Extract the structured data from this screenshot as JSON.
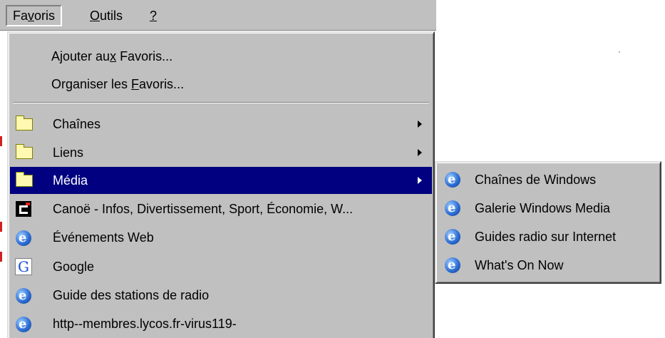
{
  "menubar": {
    "items": [
      {
        "label_pre": "Fa",
        "label_ul": "v",
        "label_post": "oris"
      },
      {
        "label_pre": "",
        "label_ul": "O",
        "label_post": "utils"
      },
      {
        "label_pre": "",
        "label_ul": "?",
        "label_post": ""
      }
    ]
  },
  "favorites_menu": {
    "add": {
      "pre": "Ajouter au",
      "ul": "x",
      "post": " Favoris..."
    },
    "organize": {
      "pre": "Organiser les ",
      "ul": "F",
      "post": "avoris..."
    },
    "items": [
      {
        "label": "Chaînes",
        "icon": "folder-icon",
        "submenu": true
      },
      {
        "label": "Liens",
        "icon": "folder-icon",
        "submenu": true
      },
      {
        "label": "Média",
        "icon": "folder-icon",
        "submenu": true,
        "selected": true
      },
      {
        "label": "Canoë - Infos, Divertissement, Sport, Économie, W...",
        "icon": "canoe-icon"
      },
      {
        "label": "Événements Web",
        "icon": "ie-icon"
      },
      {
        "label": "Google",
        "icon": "google-icon"
      },
      {
        "label": "Guide des stations de radio",
        "icon": "ie-icon"
      },
      {
        "label": "http--membres.lycos.fr-virus119-",
        "icon": "ie-icon"
      }
    ]
  },
  "media_submenu": {
    "items": [
      {
        "label": "Chaînes de Windows",
        "icon": "ie-icon"
      },
      {
        "label": "Galerie Windows Media",
        "icon": "ie-icon"
      },
      {
        "label": "Guides radio sur Internet",
        "icon": "ie-icon"
      },
      {
        "label": "What's On Now",
        "icon": "ie-icon"
      }
    ]
  },
  "colors": {
    "menu_bg": "#c0c0c0",
    "selection_bg": "#000080",
    "selection_text": "#ffffff"
  }
}
